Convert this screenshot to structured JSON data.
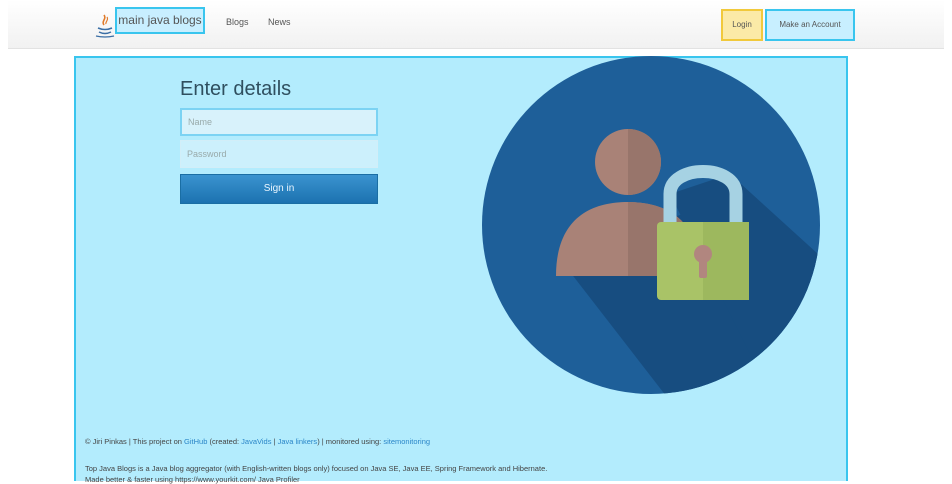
{
  "navbar": {
    "brand": "main java blogs",
    "links": [
      "Blogs",
      "News"
    ],
    "login": "Login",
    "make_account": "Make an Account"
  },
  "form": {
    "heading": "Enter details",
    "name_placeholder": "Name",
    "password_placeholder": "Password",
    "signin_label": "Sign in"
  },
  "footer": {
    "line1": {
      "a": "© Jiri Pinkas | This project on ",
      "github": "GitHub",
      "b": " (created: ",
      "javavids": "JavaVids",
      "sep": " | ",
      "javalinks": "Java linkers",
      "c": ") | monitored using: ",
      "monitor": "sitemonitoring"
    },
    "line2": "Top Java Blogs is a Java blog aggregator (with English-written blogs only) focused on Java SE, Java EE, Spring Framework and Hibernate.",
    "line3": "Made better & faster using https://www.yourkit.com/ Java Profiler"
  },
  "colors": {
    "panel": "#b3ecfd",
    "highlight": "#39c5ee",
    "login_highlight": "#f1c93b",
    "signin": "#1c72b0",
    "circle": "#1e5f99"
  },
  "icons": {
    "logo": "java-logo-icon",
    "illustration": "user-lock-icon"
  }
}
